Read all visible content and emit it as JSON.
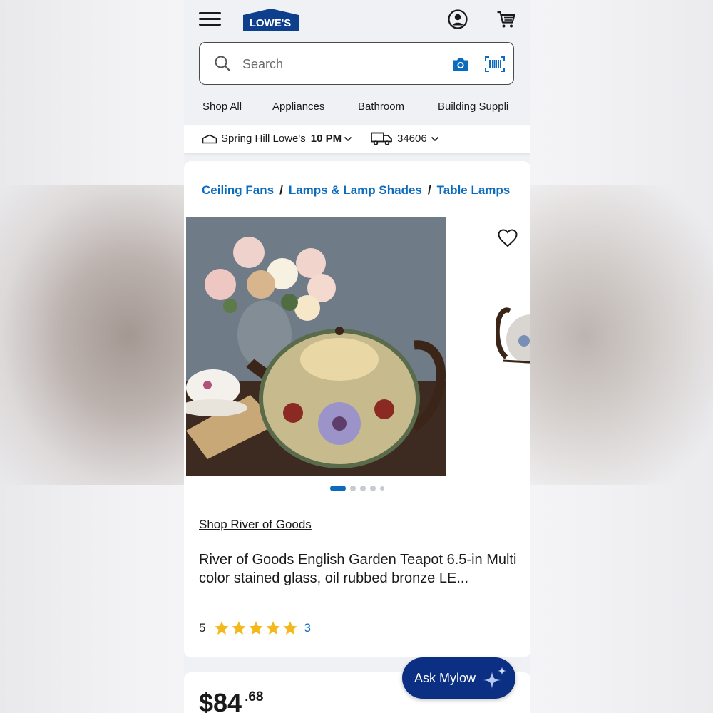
{
  "header": {
    "logo_text": "LOWE'S",
    "icons": [
      "hamburger-menu-icon",
      "account-icon",
      "cart-icon"
    ]
  },
  "search": {
    "placeholder": "Search",
    "icons": [
      "search-icon",
      "camera-icon",
      "barcode-icon"
    ]
  },
  "categories": [
    "Shop All",
    "Appliances",
    "Bathroom",
    "Building Suppli"
  ],
  "store_bar": {
    "store_name": "Spring Hill Lowe's",
    "hours": "10 PM",
    "zip": "34606"
  },
  "breadcrumbs": [
    "Ceiling Fans",
    "Lamps & Lamp Shades",
    "Table Lamps"
  ],
  "breadcrumb_separator": "/",
  "gallery": {
    "image_count": 5,
    "active_index": 0
  },
  "product": {
    "brand_link": "Shop River of Goods",
    "title": "River of Goods English Garden Teapot 6.5-in Multi color stained glass, oil rubbed bronze LE...",
    "rating_value": "5",
    "stars": 5,
    "review_count": "3"
  },
  "price": {
    "dollars": "$84",
    "cents": ".68"
  },
  "assistant": {
    "label": "Ask Mylow"
  },
  "colors": {
    "brand_blue": "#0d3f8c",
    "link_blue": "#0d6bbd",
    "star_gold": "#f3b81a",
    "mylow_navy": "#0b2f82"
  }
}
